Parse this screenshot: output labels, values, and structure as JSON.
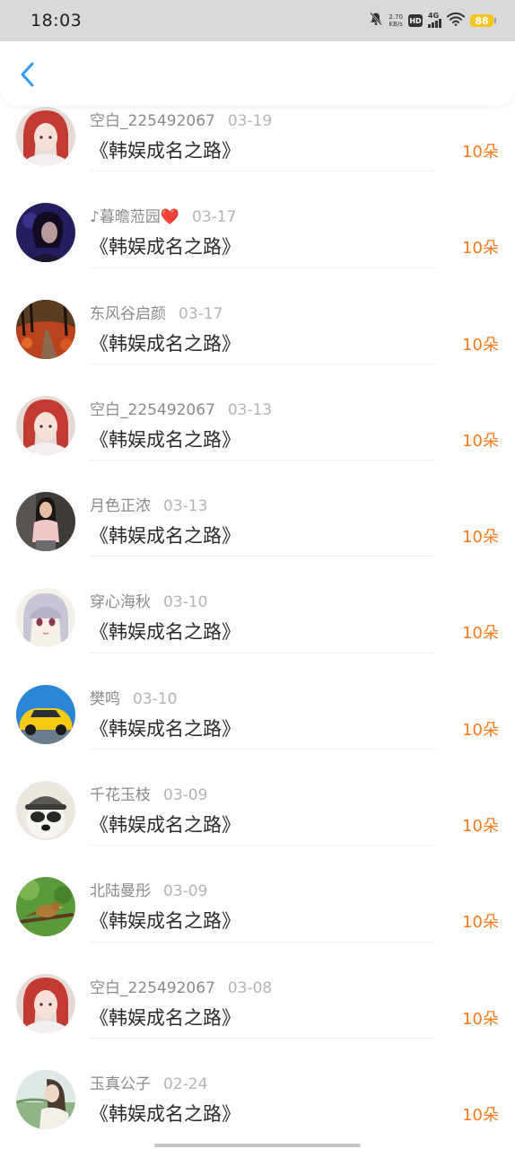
{
  "status_bar": {
    "time": "18:03",
    "net_speed_value": "2.70",
    "net_speed_unit": "KB/s",
    "hd_label": "HD",
    "network_label": "4G",
    "battery": "88"
  },
  "colors": {
    "accent_blue": "#2f9bf5",
    "amount_orange": "#ff7a1a",
    "battery_yellow": "#f5c518"
  },
  "rows": [
    {
      "name": "空白_225492067",
      "date": "03-19",
      "title": "《韩娱成名之路》",
      "amount": "10朵",
      "avatar": "avatar-red-hair-girl"
    },
    {
      "name": "♪暮曕蒞园❤️",
      "date": "03-17",
      "title": "《韩娱成名之路》",
      "amount": "10朵",
      "avatar": "avatar-dark-purple-portrait"
    },
    {
      "name": "东风谷启颜",
      "date": "03-17",
      "title": "《韩娱成名之路》",
      "amount": "10朵",
      "avatar": "avatar-autumn-road"
    },
    {
      "name": "空白_225492067",
      "date": "03-13",
      "title": "《韩娱成名之路》",
      "amount": "10朵",
      "avatar": "avatar-red-hair-girl"
    },
    {
      "name": "月色正浓",
      "date": "03-13",
      "title": "《韩娱成名之路》",
      "amount": "10朵",
      "avatar": "avatar-girl-pink-shirt"
    },
    {
      "name": "穿心海秋",
      "date": "03-10",
      "title": "《韩娱成名之路》",
      "amount": "10朵",
      "avatar": "avatar-anime-girl"
    },
    {
      "name": "樊鸣",
      "date": "03-10",
      "title": "《韩娱成名之路》",
      "amount": "10朵",
      "avatar": "avatar-yellow-car"
    },
    {
      "name": "千花玉枝",
      "date": "03-09",
      "title": "《韩娱成名之路》",
      "amount": "10朵",
      "avatar": "avatar-dog-with-hat"
    },
    {
      "name": "北陆曼彤",
      "date": "03-09",
      "title": "《韩娱成名之路》",
      "amount": "10朵",
      "avatar": "avatar-bird-on-branch"
    },
    {
      "name": "空白_225492067",
      "date": "03-08",
      "title": "《韩娱成名之路》",
      "amount": "10朵",
      "avatar": "avatar-red-hair-girl"
    },
    {
      "name": "玉真公子",
      "date": "02-24",
      "title": "《韩娱成名之路》",
      "amount": "10朵",
      "avatar": "avatar-woman-field"
    }
  ]
}
